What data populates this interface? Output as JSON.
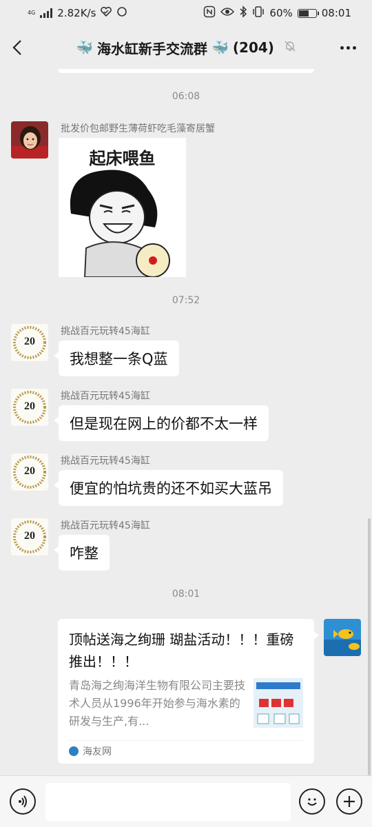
{
  "status_bar": {
    "net_speed": "2.82K/s",
    "battery_pct": "60%",
    "battery_level": 0.6,
    "time": "08:01",
    "network_label": "4G"
  },
  "header": {
    "title": "海水缸新手交流群",
    "member_count": "(204)"
  },
  "chat": {
    "messages": [
      {
        "type": "timestamp",
        "text": "06:08"
      },
      {
        "type": "sticker",
        "sender": "批发价包邮野生薄荷虾吃毛藻寄居蟹",
        "caption": "起床喂鱼",
        "avatar": "girl-avatar"
      },
      {
        "type": "timestamp",
        "text": "07:52"
      },
      {
        "type": "text",
        "sender": "挑战百元玩转45海缸",
        "text": "我想整一条Q蓝",
        "avatar": "badge-20-avatar"
      },
      {
        "type": "text",
        "sender": "挑战百元玩转45海缸",
        "text": "但是现在网上的价都不太一样",
        "avatar": "badge-20-avatar"
      },
      {
        "type": "text",
        "sender": "挑战百元玩转45海缸",
        "text": "便宜的怕坑贵的还不如买大蓝吊",
        "avatar": "badge-20-avatar"
      },
      {
        "type": "text",
        "sender": "挑战百元玩转45海缸",
        "text": "咋整",
        "avatar": "badge-20-avatar"
      },
      {
        "type": "timestamp",
        "text": "08:01"
      }
    ],
    "link_card": {
      "title": "顶帖送海之绚珊 瑚盐活动！！！重磅推出！！！",
      "description": "青岛海之绚海洋生物有限公司主要技术人员从1996年开始参与海水素的研发与生产,有...",
      "source": "海友网",
      "avatar": "fish-avatar"
    }
  },
  "avatar_badge_text": "20",
  "colors": {
    "background": "#ededed",
    "bubble": "#ffffff",
    "secondary_text": "#8a8a8a"
  }
}
